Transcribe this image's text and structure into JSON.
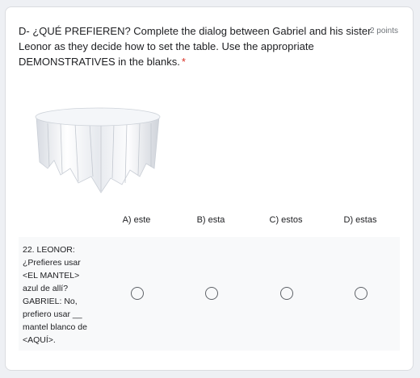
{
  "question": {
    "title": "D- ¿QUÉ PREFIEREN? Complete the dialog between Gabriel and his sister Leonor as they decide how to set the table. Use the appropriate DEMONSTRATIVES in the blanks.",
    "required_mark": "*",
    "points": "2 points"
  },
  "image": {
    "description_icon": "tablecloth-table-image"
  },
  "grid": {
    "columns": [
      "A) este",
      "B) esta",
      "C) estos",
      "D) estas"
    ],
    "rows": [
      {
        "label": "22. LEONOR:\n¿Prefieres usar\n<EL MANTEL>\nazul de allí?\nGABRIEL: No,\nprefiero usar __\nmantel blanco de\n<AQUÍ>."
      }
    ]
  },
  "colors": {
    "background": "#eef0f4",
    "card": "#ffffff",
    "row_background": "#f8f9fa",
    "required": "#d93025",
    "radio_border": "#5f6368"
  }
}
